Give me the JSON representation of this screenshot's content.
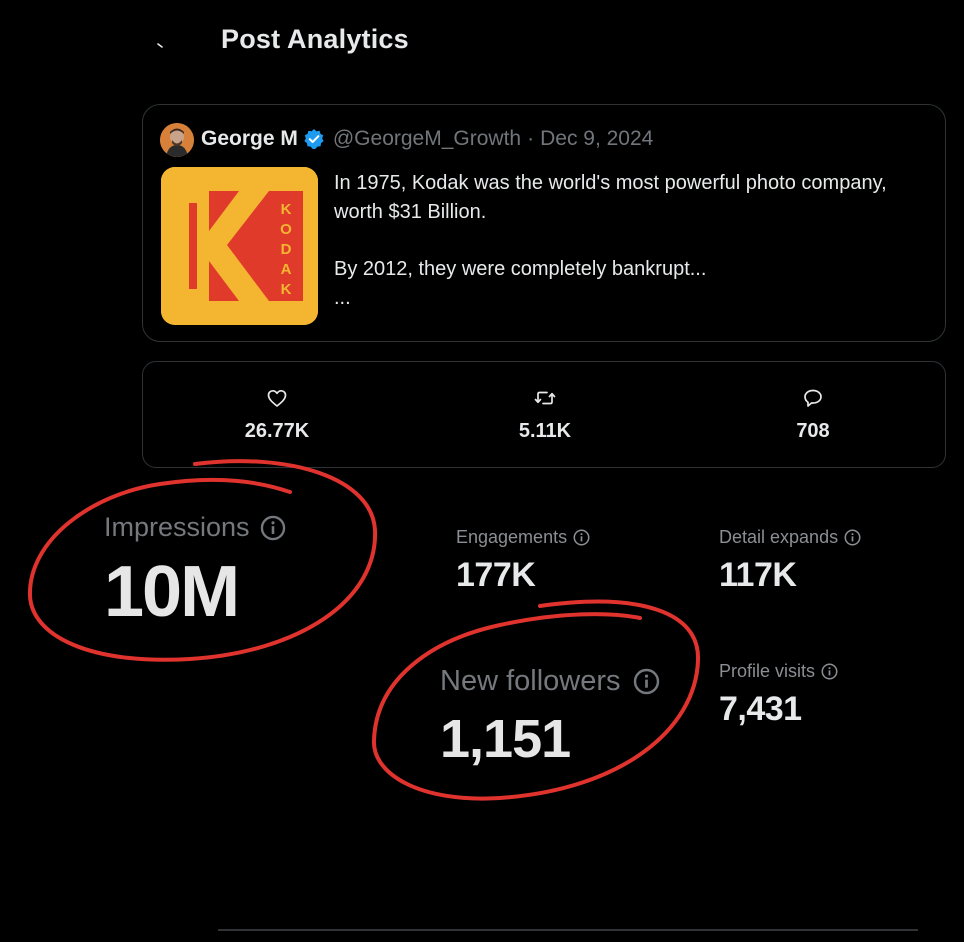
{
  "header": {
    "title": "Post Analytics",
    "back_icon": "back-arrow-icon"
  },
  "post": {
    "author_name": "George M",
    "handle": "@GeorgeM_Growth",
    "separator": "·",
    "date": "Dec 9, 2024",
    "verified": true,
    "thumbnail_letters": [
      "K",
      "O",
      "D",
      "A",
      "K"
    ],
    "text_lines": [
      "In 1975, Kodak was the world's most powerful photo company, worth $31 Billion.",
      "By 2012, they were completely bankrupt...",
      "..."
    ]
  },
  "engagement": {
    "likes": {
      "icon": "heart-icon",
      "value": "26.77K"
    },
    "reposts": {
      "icon": "repost-icon",
      "value": "5.11K"
    },
    "replies": {
      "icon": "reply-icon",
      "value": "708"
    }
  },
  "metrics": {
    "impressions": {
      "label": "Impressions",
      "value": "10M"
    },
    "engagements": {
      "label": "Engagements",
      "value": "177K"
    },
    "detail_expands": {
      "label": "Detail expands",
      "value": "117K"
    },
    "new_followers": {
      "label": "New followers",
      "value": "1,151"
    },
    "profile_visits": {
      "label": "Profile visits",
      "value": "7,431"
    }
  },
  "colors": {
    "background": "#000000",
    "border": "#2f3336",
    "verified_blue": "#1d9bf0",
    "annotation_red": "#e0332e",
    "kodak_yellow": "#f4b630",
    "kodak_red": "#e03a2b"
  }
}
